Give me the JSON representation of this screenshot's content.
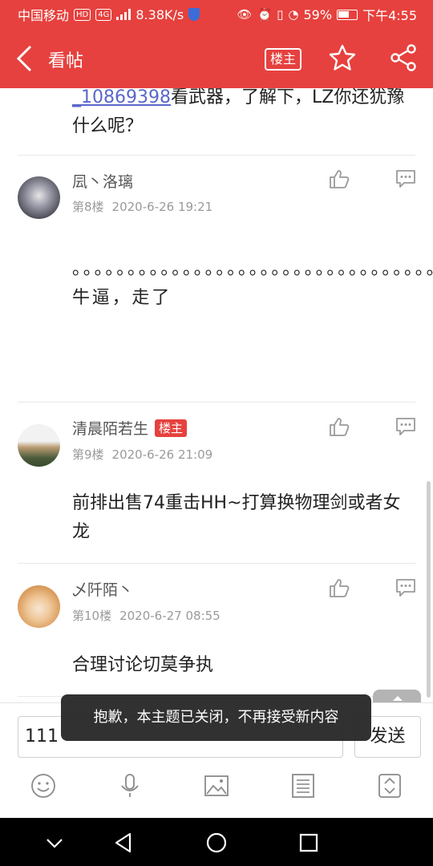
{
  "status_bar": {
    "carrier": "中国移动",
    "hd_badge": "HD",
    "signal": "4G",
    "speed": "8.38K/s",
    "battery": "59%",
    "time": "下午4:55"
  },
  "header": {
    "title": "看帖",
    "owner_button": "楼主",
    "accent_color": "#e6413e"
  },
  "top_fragment": {
    "mention": "_10869398",
    "text": "看武器，了解下，LZ你还犹豫什么呢？"
  },
  "posts": [
    {
      "username": "凨丶洛璃",
      "is_owner": false,
      "floor": "第8楼",
      "time": "2020-6-26 19:21",
      "text": "。。。。。。。。。。。。。。。。。。。。。。。。。。。。。。。。。。。。。。。。。。。。。。。。。。。。。。。。。。。。。。。。牛逼，走了"
    },
    {
      "username": "清晨陌若生",
      "owner_tag": "楼主",
      "floor": "第9楼",
      "time": "2020-6-26 21:09",
      "text": "前排出售74重击HH~打算换物理剑或者女龙"
    },
    {
      "username": "乄阡陌丶",
      "is_owner": false,
      "floor": "第10楼",
      "time": "2020-6-27 08:55",
      "text": "合理讨论切莫争执"
    }
  ],
  "composer": {
    "input_value": "111",
    "send_label": "发送"
  },
  "toast": "抱歉，本主题已关闭，不再接受新内容",
  "icons": {
    "back": "back-arrow-icon",
    "star": "star-icon",
    "share": "share-icon",
    "like": "thumb-up-icon",
    "reply": "comment-icon",
    "emoji": "emoji-icon",
    "voice": "microphone-icon",
    "image": "image-icon",
    "list": "list-icon",
    "expand": "expand-icon"
  }
}
